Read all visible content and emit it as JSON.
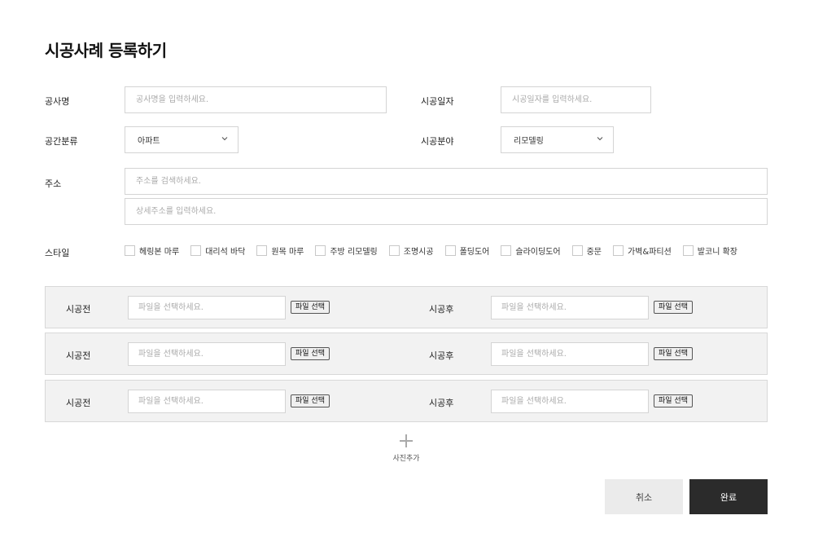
{
  "page_title": "시공사례 등록하기",
  "form": {
    "project_name": {
      "label": "공사명",
      "placeholder": "공사명을 입력하세요."
    },
    "construction_date": {
      "label": "시공일자",
      "placeholder": "시공일자를 입력하세요."
    },
    "space_category": {
      "label": "공간분류",
      "value": "아파트"
    },
    "construction_field": {
      "label": "시공분야",
      "value": "리모델링"
    },
    "address": {
      "label": "주소",
      "placeholder": "주소를 검색하세요.",
      "detail_placeholder": "상세주소를 입력하세요."
    },
    "style": {
      "label": "스타일",
      "options": [
        "헤링본 마루",
        "대리석 바닥",
        "원목 마루",
        "주방 리모델링",
        "조명시공",
        "폴딩도어",
        "슬라이딩도어",
        "중문",
        "가벽&파티션",
        "발코니 확장"
      ]
    }
  },
  "photos": {
    "before_label": "시공전",
    "after_label": "시공후",
    "file_placeholder": "파일을 선택하세요.",
    "file_button": "파일 선택",
    "add_label": "사진추가"
  },
  "buttons": {
    "cancel": "취소",
    "done": "완료"
  },
  "icons": {
    "select_arrow": "chevron-down-icon",
    "add_photo": "plus-icon"
  }
}
